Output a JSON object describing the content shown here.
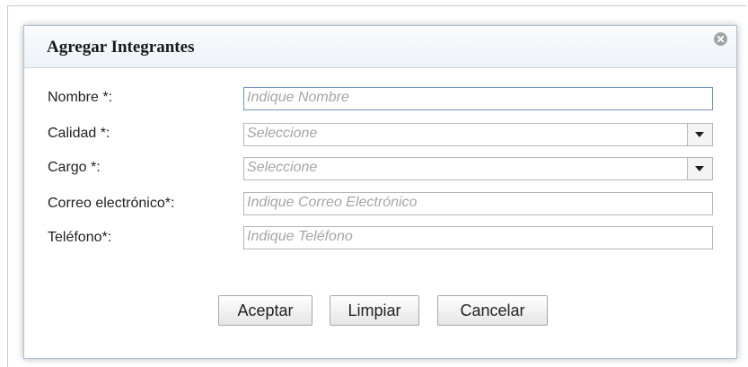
{
  "dialog": {
    "title": "Agregar Integrantes",
    "close_icon": "close-circle-icon"
  },
  "form": {
    "nombre": {
      "label": "Nombre *:",
      "placeholder": "Indique Nombre"
    },
    "calidad": {
      "label": "Calidad *:",
      "selected": "Seleccione"
    },
    "cargo": {
      "label": "Cargo *:",
      "selected": "Seleccione"
    },
    "correo": {
      "label": "Correo electrónico*:",
      "placeholder": "Indique Correo Electrónico"
    },
    "telefono": {
      "label": "Teléfono*:",
      "placeholder": "Indique Teléfono"
    }
  },
  "buttons": {
    "accept": "Aceptar",
    "clear": "Limpiar",
    "cancel": "Cancelar"
  },
  "colors": {
    "dialog_border": "#a9c1d3",
    "focused_input_border": "#6f95b9",
    "placeholder_text": "#a5a5a5"
  }
}
